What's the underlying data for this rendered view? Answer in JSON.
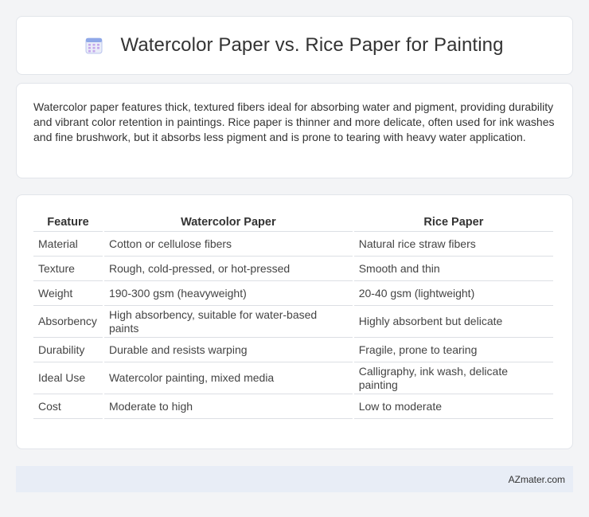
{
  "header": {
    "title": "Watercolor Paper vs. Rice Paper for Painting",
    "icon": "calendar-icon"
  },
  "intro": {
    "text": "Watercolor paper features thick, textured fibers ideal for absorbing water and pigment, providing durability and vibrant color retention in paintings. Rice paper is thinner and more delicate, often used for ink washes and fine brushwork, but it absorbs less pigment and is prone to tearing with heavy water application."
  },
  "table": {
    "headers": [
      "Feature",
      "Watercolor Paper",
      "Rice Paper"
    ],
    "rows": [
      [
        "Material",
        "Cotton or cellulose fibers",
        "Natural rice straw fibers"
      ],
      [
        "Texture",
        "Rough, cold-pressed, or hot-pressed",
        "Smooth and thin"
      ],
      [
        "Weight",
        "190-300 gsm (heavyweight)",
        "20-40 gsm (lightweight)"
      ],
      [
        "Absorbency",
        "High absorbency, suitable for water-based paints",
        "Highly absorbent but delicate"
      ],
      [
        "Durability",
        "Durable and resists warping",
        "Fragile, prone to tearing"
      ],
      [
        "Ideal Use",
        "Watercolor painting, mixed media",
        "Calligraphy, ink wash, delicate painting"
      ],
      [
        "Cost",
        "Moderate to high",
        "Low to moderate"
      ]
    ]
  },
  "footer": {
    "site": "AZmater.com"
  },
  "colors": {
    "page_bg": "#f3f4f6",
    "footer_bg": "#e8edf6",
    "icon_accent": "#8fa8e8"
  }
}
